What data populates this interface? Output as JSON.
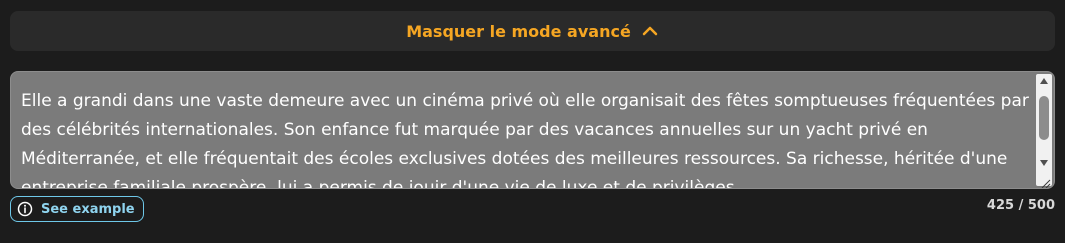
{
  "advanced_toggle": {
    "label": "Masquer le mode avancé",
    "color": "#f5a623",
    "icon": "chevron-up-icon"
  },
  "prompt": {
    "text": "Elle a grandi dans une vaste demeure avec un cinéma privé où elle organisait des fêtes somptueuses fréquentées par des célébrités internationales. Son enfance fut marquée par des vacances annuelles sur un yacht privé en Méditerranée, et elle fréquentait des écoles exclusives dotées des meilleures ressources. Sa richesse, héritée d'une entreprise familiale prospère, lui a permis de jouir d'une vie de luxe et de privilèges."
  },
  "see_example": {
    "label": "See example",
    "icon": "info-icon"
  },
  "char_count": {
    "text": "425 / 500"
  }
}
